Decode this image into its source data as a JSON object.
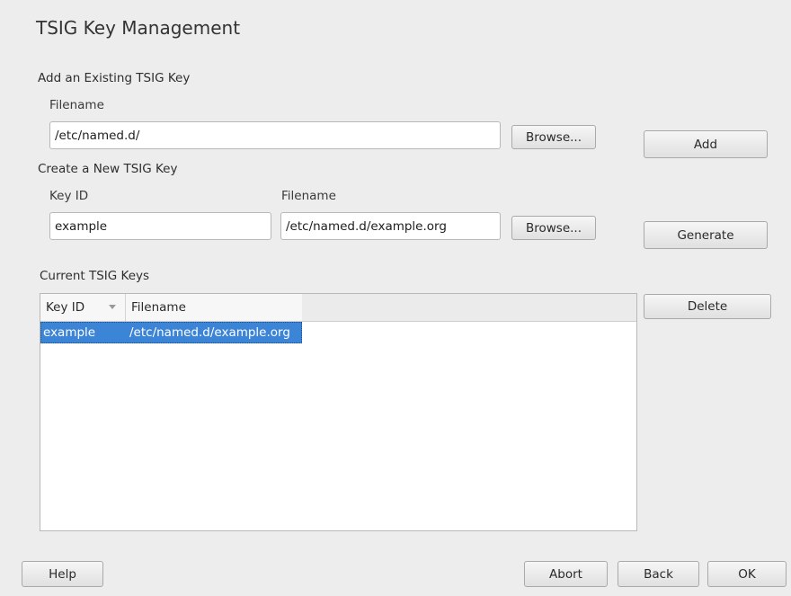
{
  "dialog": {
    "title": "TSIG Key Management"
  },
  "add_existing": {
    "section_label": "Add an Existing TSIG Key",
    "filename_label": "Filename",
    "filename_value": "/etc/named.d/",
    "browse_label": "Browse...",
    "add_label": "Add"
  },
  "create_new": {
    "section_label": "Create a New TSIG Key",
    "key_id_label": "Key ID",
    "key_id_value": "example",
    "filename_label": "Filename",
    "filename_value": "/etc/named.d/example.org",
    "browse_label": "Browse...",
    "generate_label": "Generate"
  },
  "current_keys": {
    "section_label": "Current TSIG Keys",
    "columns": [
      "Key ID",
      "Filename"
    ],
    "rows": [
      {
        "key_id": "example",
        "filename": "/etc/named.d/example.org",
        "selected": true
      }
    ],
    "delete_label": "Delete"
  },
  "footer": {
    "help_label": "Help",
    "abort_label": "Abort",
    "back_label": "Back",
    "ok_label": "OK"
  }
}
